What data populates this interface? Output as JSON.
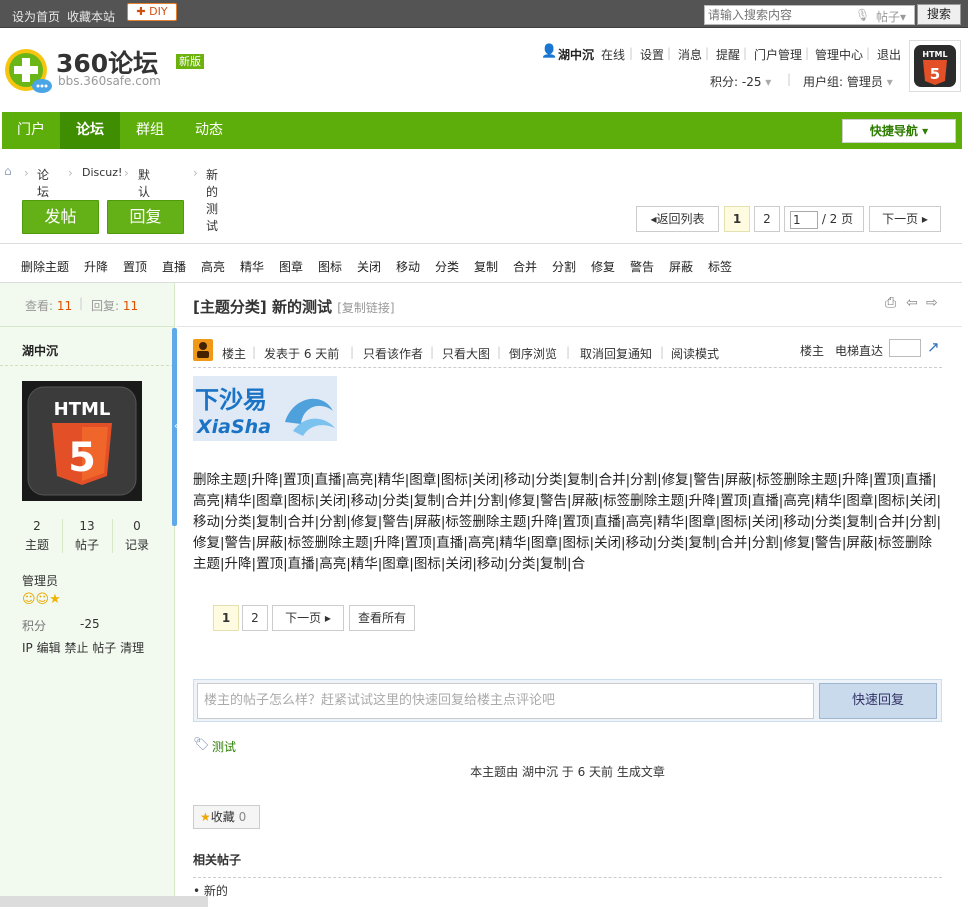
{
  "topbar": {
    "set_home": "设为首页",
    "bookmark": "收藏本站",
    "diy": "DIY",
    "search_placeholder": "请输入搜索内容",
    "search_type": "帖子",
    "search_button": "搜索"
  },
  "brand": {
    "name": "360论坛",
    "badge": "新版",
    "url": "bbs.360safe.com",
    "accent": "#5eae0b"
  },
  "user": {
    "name": "湖中沉",
    "status": "在线",
    "links": [
      "设置",
      "消息",
      "提醒",
      "门户管理",
      "管理中心",
      "退出"
    ],
    "points_label": "积分: -25",
    "group_label": "用户组: 管理员"
  },
  "nav": {
    "items": [
      "门户",
      "论坛",
      "群组",
      "动态"
    ],
    "active": "论坛",
    "quick": "快捷导航"
  },
  "breadcrumb": [
    "论坛",
    "Discuz!",
    "默认版块",
    "新的测试"
  ],
  "actions": {
    "post": "发帖",
    "reply": "回复",
    "back": "返回列表",
    "pages": [
      "1",
      "2"
    ],
    "page_input": "1",
    "page_total": "/ 2 页",
    "next": "下一页"
  },
  "mod_actions": [
    "删除主题",
    "升降",
    "置顶",
    "直播",
    "高亮",
    "精华",
    "图章",
    "图标",
    "关闭",
    "移动",
    "分类",
    "复制",
    "合并",
    "分割",
    "修复",
    "警告",
    "屏蔽",
    "标签"
  ],
  "sidebar": {
    "views_label": "查看:",
    "views": "11",
    "replies_label": "回复:",
    "replies": "11",
    "author": "湖中沉",
    "stats": [
      {
        "value": "2",
        "label": "主题"
      },
      {
        "value": "13",
        "label": "帖子"
      },
      {
        "value": "0",
        "label": "记录"
      }
    ],
    "group": "管理员",
    "points_label": "积分",
    "points": "-25",
    "admin_links": [
      "IP",
      "编辑",
      "禁止",
      "帖子",
      "清理"
    ]
  },
  "thread": {
    "category": "[主题分类]",
    "title": "新的测试",
    "copy_link": "[复制链接]"
  },
  "post": {
    "role": "楼主",
    "posted": "发表于 6 天前",
    "tools": [
      "只看该作者",
      "只看大图",
      "倒序浏览",
      "取消回复通知",
      "阅读模式"
    ],
    "floor": "楼主",
    "elevator": "电梯直达",
    "image_text": "下沙易",
    "image_sub": "XiaSha",
    "body": "删除主题|升降|置顶|直播|高亮|精华|图章|图标|关闭|移动|分类|复制|合并|分割|修复|警告|屏蔽|标签删除主题|升降|置顶|直播|高亮|精华|图章|图标|关闭|移动|分类|复制|合并|分割|修复|警告|屏蔽|标签删除主题|升降|置顶|直播|高亮|精华|图章|图标|关闭|移动|分类|复制|合并|分割|修复|警告|屏蔽|标签删除主题|升降|置顶|直播|高亮|精华|图章|图标|关闭|移动|分类|复制|合并|分割|修复|警告|屏蔽|标签删除主题|升降|置顶|直播|高亮|精华|图章|图标|关闭|移动|分类|复制|合并|分割|修复|警告|屏蔽|标签删除主题|升降|置顶|直播|高亮|精华|图章|图标|关闭|移动|分类|复制|合",
    "pages": [
      "1",
      "2"
    ],
    "next": "下一页",
    "view_all": "查看所有"
  },
  "quick_reply": {
    "placeholder": "楼主的帖子怎么样？赶紧试试这里的快速回复给楼主点评论吧",
    "button": "快速回复"
  },
  "tag": "测试",
  "article_note": "本主题由 湖中沉 于 6 天前 生成文章",
  "favorite": {
    "label": "收藏",
    "count": "0"
  },
  "related": {
    "title": "相关帖子",
    "items": [
      "新的"
    ]
  }
}
